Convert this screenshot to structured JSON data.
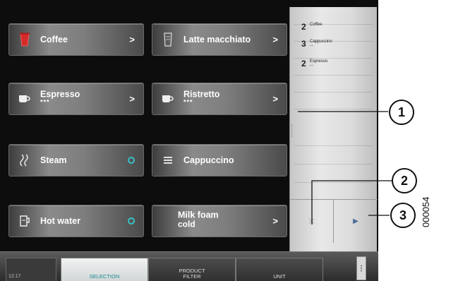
{
  "products": [
    {
      "label": "Coffee",
      "sub": "",
      "indicator": "arrow",
      "icon": "red-cup-icon"
    },
    {
      "label": "Latte macchiato",
      "sub": "",
      "indicator": "arrow",
      "icon": "latte-glass-icon"
    },
    {
      "label": "Espresso",
      "sub": "***",
      "indicator": "arrow",
      "icon": "espresso-cup-icon"
    },
    {
      "label": "Ristretto",
      "sub": "***",
      "indicator": "arrow",
      "icon": "ristretto-cup-icon"
    },
    {
      "label": "Steam",
      "sub": "",
      "indicator": "ring",
      "icon": "steam-icon"
    },
    {
      "label": "Cappuccino",
      "sub": "",
      "indicator": "none",
      "icon": "menu-lines-icon"
    },
    {
      "label": "Hot water",
      "sub": "",
      "indicator": "ring",
      "icon": "hot-water-icon"
    },
    {
      "label": "Milk foam",
      "sub": "cold",
      "indicator": "arrow",
      "icon": "milk-foam-icon"
    }
  ],
  "arrow_glyph": ">",
  "order_list": [
    {
      "qty": "2",
      "name": "Coffee",
      "strength": ""
    },
    {
      "qty": "3",
      "name": "Cappuccino",
      "strength": "--"
    },
    {
      "qty": "2",
      "name": "Espresso",
      "strength": "--"
    }
  ],
  "order_controls": {
    "cancel": "✕",
    "next": "▶"
  },
  "bottom_bar": {
    "time": "12:17",
    "tabs": [
      {
        "label": "SELECTION",
        "active": true
      },
      {
        "label": "PRODUCT\nFILTER",
        "active": false
      },
      {
        "label": "UNIT",
        "active": false
      }
    ],
    "more": "⋮"
  },
  "callouts": [
    "1",
    "2",
    "3"
  ],
  "document_id": "000054",
  "colors": {
    "ring_accent": "#37c0c6",
    "active_tab_text": "#1a8a8f",
    "coffee_cup": "#d42a2a",
    "next_arrow": "#4a6b9a"
  }
}
